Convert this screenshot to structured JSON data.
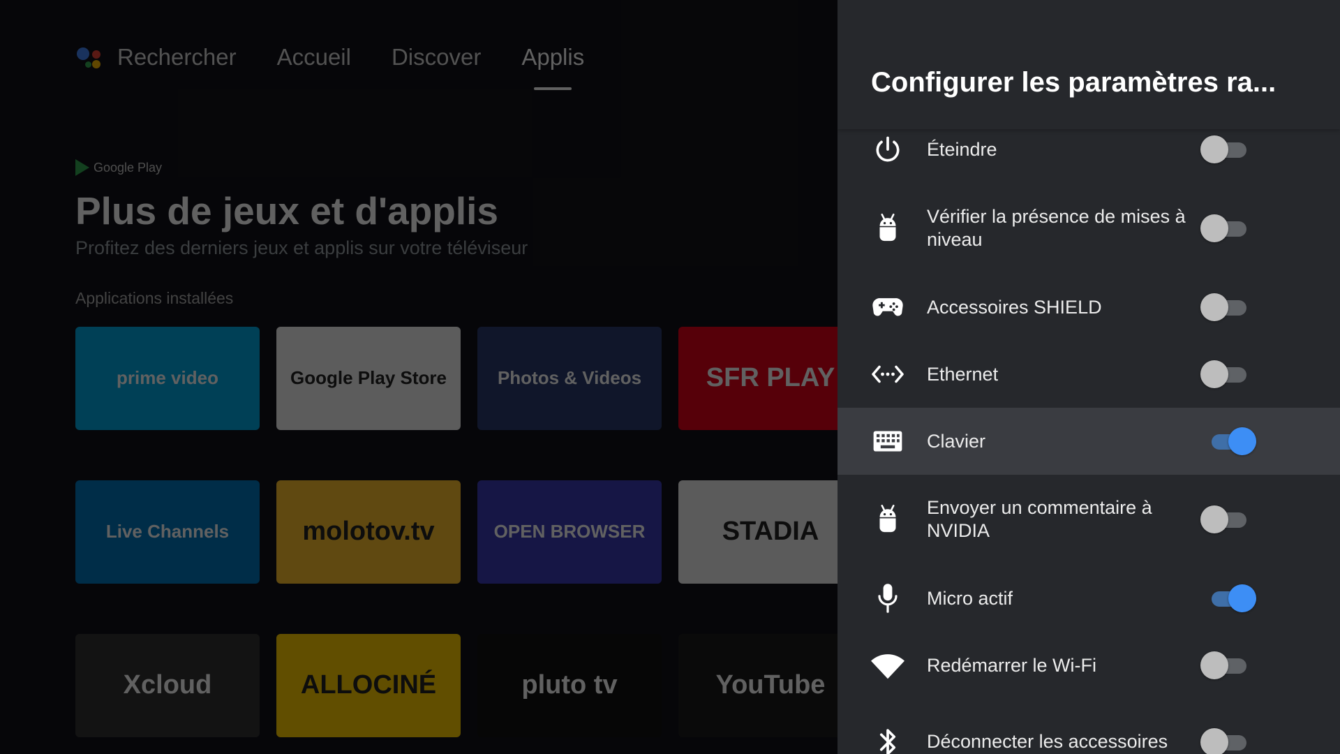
{
  "background": {
    "nav": {
      "search": "Rechercher",
      "home": "Accueil",
      "discover": "Discover",
      "apps": "Applis"
    },
    "brand": "Google Play",
    "hero_title": "Plus de jeux et d'applis",
    "hero_subtitle": "Profitez des derniers jeux et applis sur votre téléviseur",
    "section_label": "Applications installées",
    "tiles": [
      {
        "label": "prime video",
        "color": "#00a8e1"
      },
      {
        "label": "Google Play Store",
        "color": "#f1f1f1"
      },
      {
        "label": "Photos & Videos",
        "color": "#2a3a6e"
      },
      {
        "label": "SFR PLAY",
        "color": "#e2001a"
      },
      {
        "label": "Live Channels",
        "color": "#0277bd"
      },
      {
        "label": "molotov.tv",
        "color": "#fbc02d"
      },
      {
        "label": "OPEN BROWSER",
        "color": "#3b3bb5"
      },
      {
        "label": "STADIA",
        "color": "#eeeeee"
      },
      {
        "label": "Xcloud",
        "color": "#333333"
      },
      {
        "label": "ALLOCINÉ",
        "color": "#fecc00"
      },
      {
        "label": "pluto tv",
        "color": "#111111"
      },
      {
        "label": "YouTube",
        "color": "#1c1c1c"
      }
    ]
  },
  "panel": {
    "title": "Configurer les paramètres ra...",
    "items": [
      {
        "label": "Éteindre",
        "icon": "power-icon",
        "enabled": false
      },
      {
        "label": "Vérifier la présence de mises à niveau",
        "icon": "android-icon",
        "enabled": false
      },
      {
        "label": "Accessoires SHIELD",
        "icon": "gamepad-icon",
        "enabled": false
      },
      {
        "label": "Ethernet",
        "icon": "ethernet-icon",
        "enabled": false
      },
      {
        "label": "Clavier",
        "icon": "keyboard-icon",
        "enabled": true
      },
      {
        "label": "Envoyer un commentaire à NVIDIA",
        "icon": "android-icon",
        "enabled": false
      },
      {
        "label": "Micro actif",
        "icon": "microphone-icon",
        "enabled": true
      },
      {
        "label": "Redémarrer le Wi-Fi",
        "icon": "wifi-icon",
        "enabled": false
      },
      {
        "label": "Déconnecter les accessoires Bluetooth",
        "icon": "bluetooth-icon",
        "enabled": false
      }
    ],
    "focused_item": "Clavier",
    "colors": {
      "accent": "#3d8ef5",
      "panel_bg": "#26282c",
      "focus_bg": "#3a3c41"
    }
  }
}
